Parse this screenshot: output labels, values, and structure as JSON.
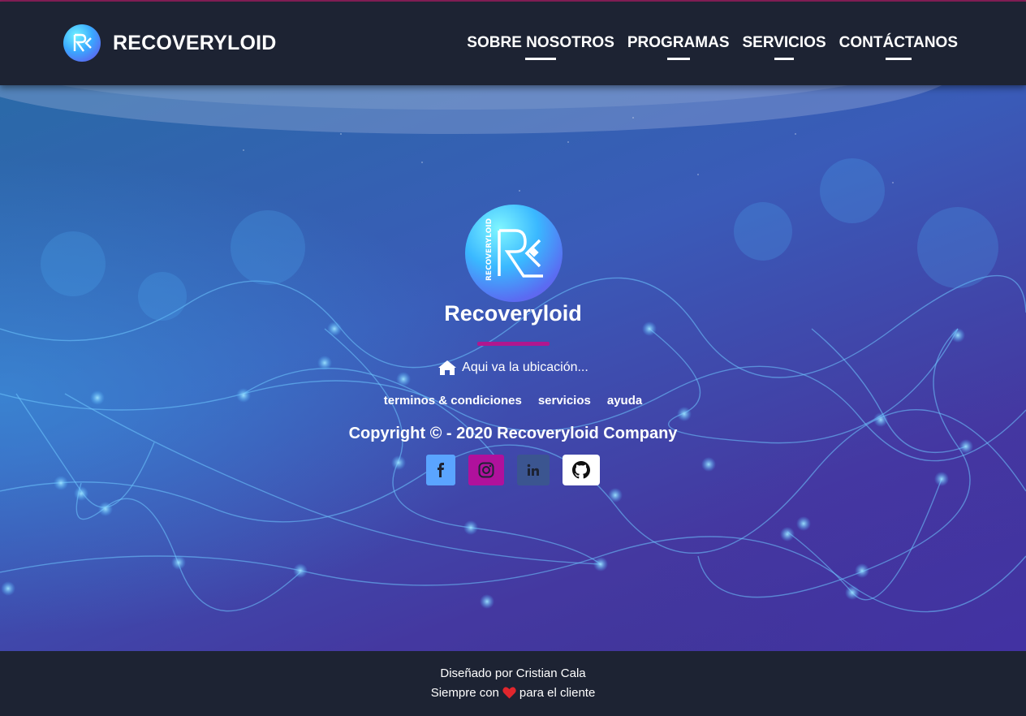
{
  "brand": {
    "name": "RECOVERYLOID",
    "logo_letters": "RC"
  },
  "nav": {
    "items": [
      {
        "label": "SOBRE NOSOTROS"
      },
      {
        "label": "PROGRAMAS"
      },
      {
        "label": "SERVICIOS"
      },
      {
        "label": "CONTÁCTANOS"
      }
    ]
  },
  "hero": {
    "logo_side_text": "RECOVERYLOID",
    "company_name": "Recoveryloid",
    "location_text": "Aqui va la ubicación...",
    "links": [
      {
        "label": "terminos & condiciones"
      },
      {
        "label": "servicios"
      },
      {
        "label": "ayuda"
      }
    ],
    "copyright": "Copyright © - 2020 Recoveryloid Company",
    "socials": [
      {
        "icon": "facebook-icon",
        "color": "#5aa4ff"
      },
      {
        "icon": "instagram-icon",
        "color": "#b0119c"
      },
      {
        "icon": "linkedin-icon",
        "color": "#3b5590"
      },
      {
        "icon": "github-icon",
        "color": "#ffffff"
      }
    ]
  },
  "footer": {
    "credit": "Diseñado por Cristian Cala",
    "tagline_before": "Siempre con",
    "tagline_after": "para el cliente"
  },
  "colors": {
    "navbar_bg": "#1d2333",
    "accent_magenta": "#b0178f",
    "heart": "#e0262d"
  }
}
